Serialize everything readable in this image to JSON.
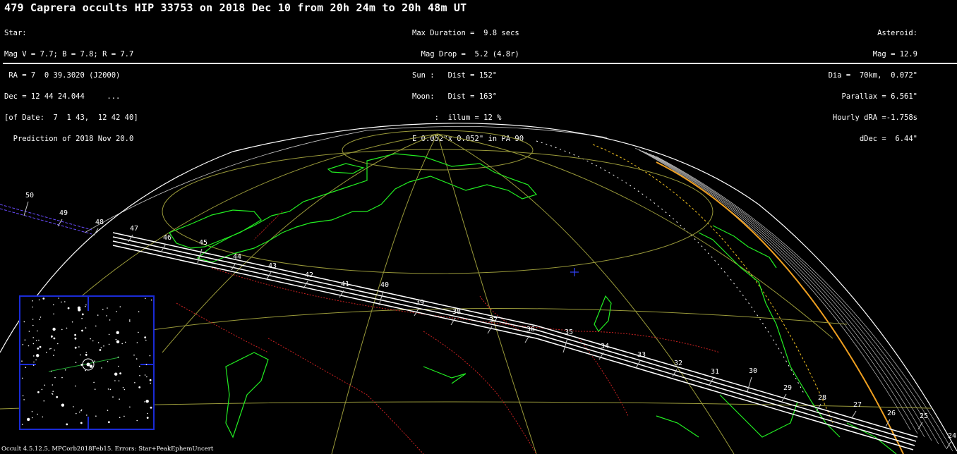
{
  "header": {
    "title": "479 Caprera occults HIP 33753 on 2018 Dec 10 from 20h 24m to 20h 48m UT",
    "star_lines": [
      "Star:",
      "Mag V = 7.7; B = 7.8; R = 7.7",
      " RA = 7  0 39.3020 (J2000)",
      "Dec = 12 44 24.044     ...",
      "[of Date:  7  1 43,  12 42 40]",
      "  Prediction of 2018 Nov 20.0"
    ],
    "event_lines": [
      "Max Duration =  9.8 secs",
      "  Mag Drop =  5.2 (4.8r)",
      "Sun :   Dist = 152°",
      "Moon:   Dist = 163°",
      "     :  illum = 12 %",
      "E 0.052\"x 0.052\" in PA 90"
    ],
    "asteroid_lines": [
      "Asteroid:",
      "Mag = 12.9",
      "Dia =  70km,  0.072\"",
      "Parallax = 6.561\"",
      "Hourly dRA =-1.758s",
      "dDec =  6.44\""
    ]
  },
  "map": {
    "path_tick_labels": [
      "50",
      "49",
      "48",
      "47",
      "46",
      "45",
      "44",
      "43",
      "42",
      "41",
      "40",
      "39",
      "38",
      "37",
      "36",
      "35",
      "34",
      "33",
      "32",
      "31",
      "30",
      "29",
      "28",
      "27",
      "26",
      "25",
      "24"
    ],
    "colors": {
      "background": "#000000",
      "coastline": "#22ee22",
      "borders": "#cc2222",
      "graticule": "#9a9a3a",
      "path": "#ffffff",
      "limb_orange": "#f0a020",
      "center_cross": "#3344ff",
      "inset_border": "#1a2bd6"
    }
  },
  "footer": "Occult 4.5.12.5, MPCorb2018Feb15. Errors: Star+PeakEphemUncert"
}
